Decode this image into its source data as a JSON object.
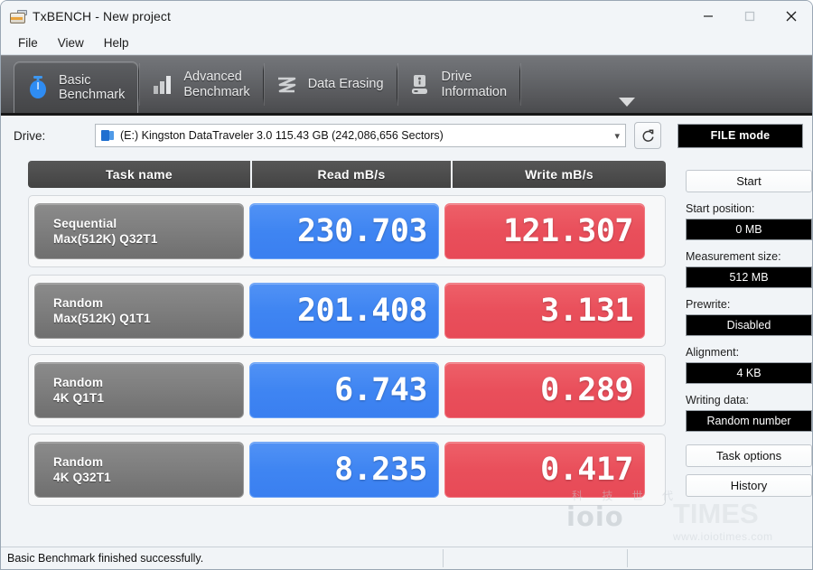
{
  "window": {
    "title": "TxBENCH - New project",
    "app_icon": "drive-icon",
    "minimize_label": "minimize-icon",
    "maximize_label": "maximize-icon",
    "close_label": "close-icon"
  },
  "menu": {
    "items": [
      {
        "label": "File"
      },
      {
        "label": "View"
      },
      {
        "label": "Help"
      }
    ]
  },
  "tabs": [
    {
      "label": "Basic\nBenchmark",
      "icon": "stopwatch-icon",
      "active": true
    },
    {
      "label": "Advanced\nBenchmark",
      "icon": "bar-chart-icon",
      "active": false
    },
    {
      "label": "Data Erasing",
      "icon": "wave-icon",
      "active": false
    },
    {
      "label": "Drive\nInformation",
      "icon": "drive-info-icon",
      "active": false
    }
  ],
  "tabs_overflow_icon": "chevron-down-icon",
  "drive": {
    "label": "Drive:",
    "selected": "(E:) Kingston DataTraveler 3.0  115.43 GB (242,086,656 Sectors)",
    "combo_icon": "device-icon",
    "dropdown_icon": "chevron-down-icon",
    "refresh_icon": "refresh-icon",
    "mode_value": "FILE mode"
  },
  "results": {
    "columns": [
      "Task name",
      "Read mB/s",
      "Write mB/s"
    ],
    "rows": [
      {
        "task_line1": "Sequential",
        "task_line2": "Max(512K) Q32T1",
        "read": "230.703",
        "write": "121.307"
      },
      {
        "task_line1": "Random",
        "task_line2": "Max(512K) Q1T1",
        "read": "201.408",
        "write": "3.131"
      },
      {
        "task_line1": "Random",
        "task_line2": "4K Q1T1",
        "read": "6.743",
        "write": "0.289"
      },
      {
        "task_line1": "Random",
        "task_line2": "4K Q32T1",
        "read": "8.235",
        "write": "0.417"
      }
    ]
  },
  "side": {
    "start_button": "Start",
    "start_position_label": "Start position:",
    "start_position_value": "0 MB",
    "measurement_size_label": "Measurement size:",
    "measurement_size_value": "512 MB",
    "prewrite_label": "Prewrite:",
    "prewrite_value": "Disabled",
    "alignment_label": "Alignment:",
    "alignment_value": "4 KB",
    "writing_data_label": "Writing data:",
    "writing_data_value": "Random number",
    "task_options_button": "Task options",
    "history_button": "History"
  },
  "status": {
    "message": "Basic Benchmark finished successfully."
  },
  "watermark": {
    "brand": "ioio",
    "brand2": "TIMES",
    "url": "www.ioiotimes.com",
    "cn": "科 技 世 代"
  },
  "colors": {
    "read_accent": "#3f85f2",
    "write_accent": "#e94f5b",
    "toolbar_dark": "#57585b",
    "header_gray": "#4c4c4c",
    "task_gray": "#7e7e7e"
  }
}
